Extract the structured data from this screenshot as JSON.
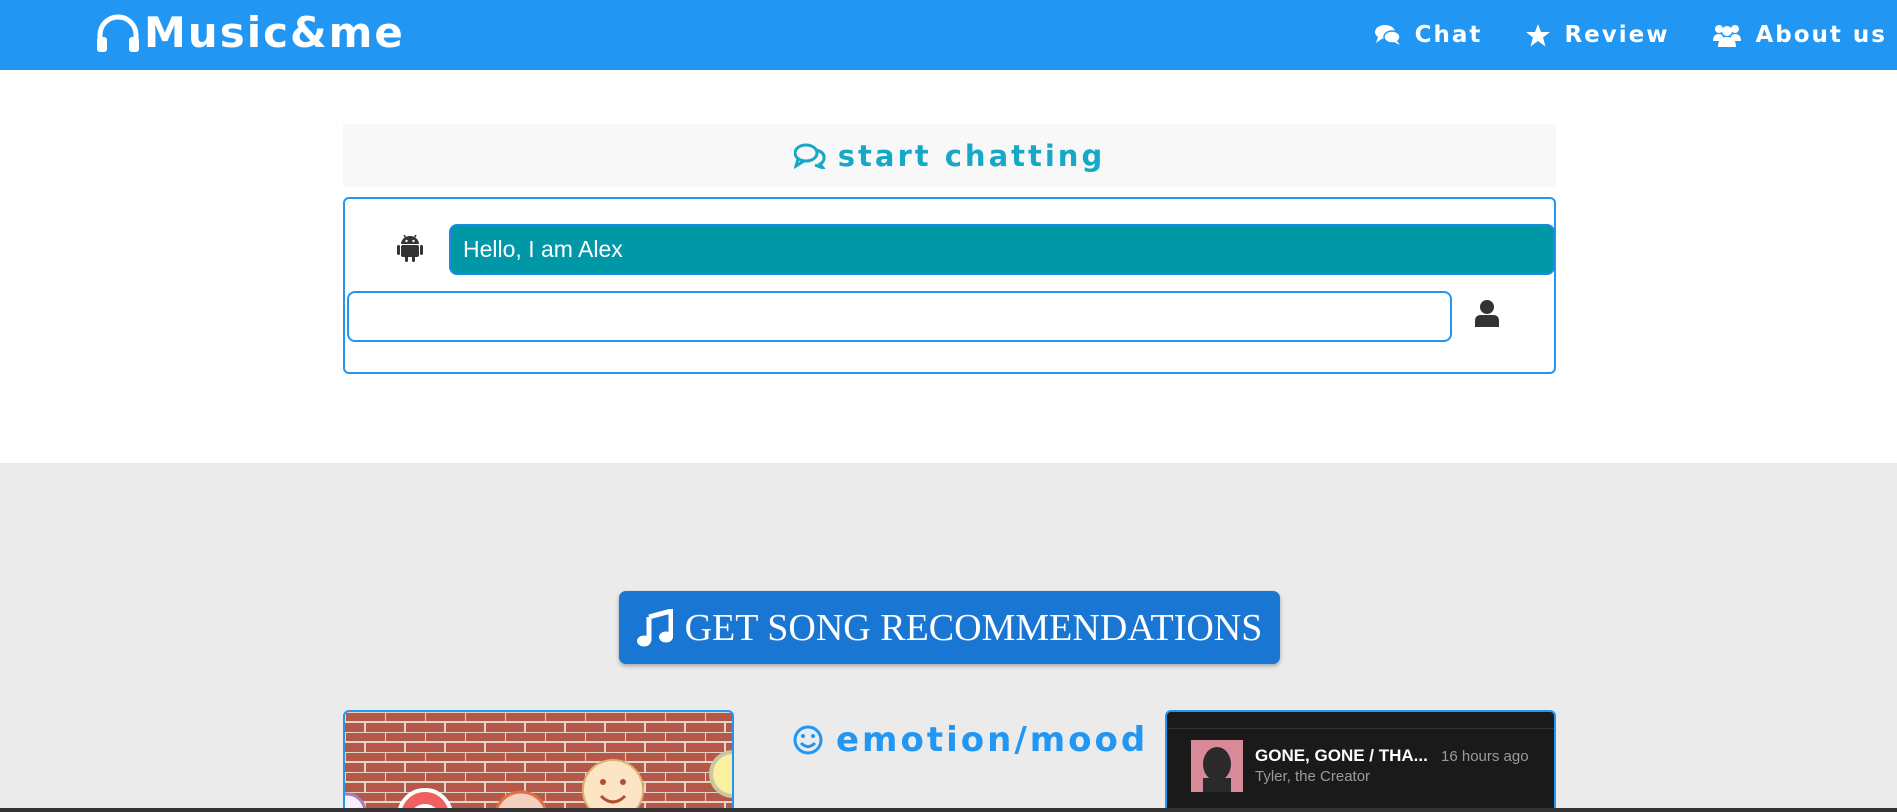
{
  "colors": {
    "primary": "#2196f3",
    "button": "#1976d2",
    "bot_bubble": "#0097a7",
    "chat_title": "#17a8c8",
    "gray_bg": "#ebebeb"
  },
  "navbar": {
    "brand": "Music&me",
    "brand_icon": "headphones-icon",
    "links": [
      {
        "label": "Chat",
        "icon": "comments-icon"
      },
      {
        "label": "Review",
        "icon": "star-icon"
      },
      {
        "label": "About us",
        "icon": "users-icon"
      }
    ]
  },
  "chat": {
    "title": "start chatting",
    "title_icon": "comments-outline-icon",
    "bot_icon": "android-icon",
    "bot_message": "Hello, I am Alex",
    "input_value": "",
    "user_icon": "user-icon"
  },
  "recommend_button": {
    "label": "GET SONG RECOMMENDATIONS",
    "icon": "music-note-icon"
  },
  "emotion": {
    "title": "emotion/mood",
    "icon": "smile-icon"
  },
  "spotify": {
    "track_title": "GONE, GONE / THA...",
    "track_time": "16 hours ago",
    "track_artist": "Tyler, the Creator"
  }
}
